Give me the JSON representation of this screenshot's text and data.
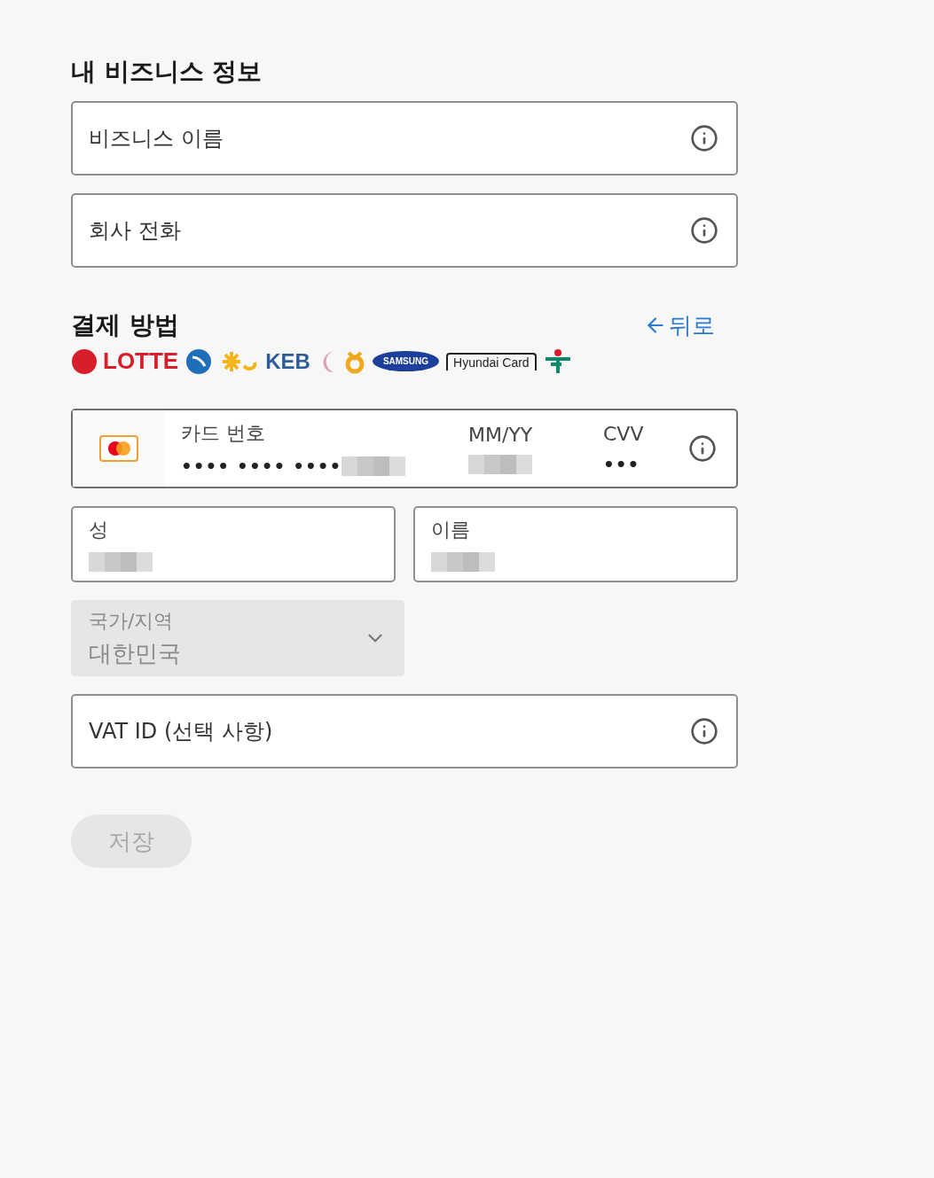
{
  "business": {
    "title": "내 비즈니스 정보",
    "fields": [
      {
        "placeholder": "비즈니스 이름"
      },
      {
        "placeholder": "회사 전화"
      }
    ]
  },
  "payment": {
    "title": "결제 방법",
    "back_link": "뒤로",
    "logos": [
      {
        "kind": "round",
        "color": "#d81e2a",
        "text": "LOTTE"
      },
      {
        "kind": "globe",
        "color": "#1e6fb8"
      },
      {
        "kind": "star",
        "color": "#f5b41a"
      },
      {
        "kind": "plain",
        "color": "#2f5d98",
        "text": "KEB"
      },
      {
        "kind": "moon",
        "color": "#d9a0b0"
      },
      {
        "kind": "ring",
        "color": "#f0a81c"
      },
      {
        "kind": "oval",
        "color": "#1b3f9a",
        "text": "SAMSUNG"
      },
      {
        "kind": "frame",
        "color": "#222222",
        "text": "Hyundai Card"
      },
      {
        "kind": "figure",
        "color": "#0a8a6a"
      }
    ],
    "card": {
      "number_label": "카드 번호",
      "number_value": "•••• •••• ••••",
      "expiry_label": "MM/YY",
      "cvv_label": "CVV",
      "cvv_value": "•••"
    },
    "names": [
      {
        "label": "성"
      },
      {
        "label": "이름"
      }
    ],
    "country": {
      "label": "국가/지역",
      "value": "대한민국",
      "disabled": true
    },
    "vat": {
      "placeholder": "VAT ID (선택 사항)"
    },
    "save": {
      "label": "저장",
      "disabled": true
    }
  }
}
